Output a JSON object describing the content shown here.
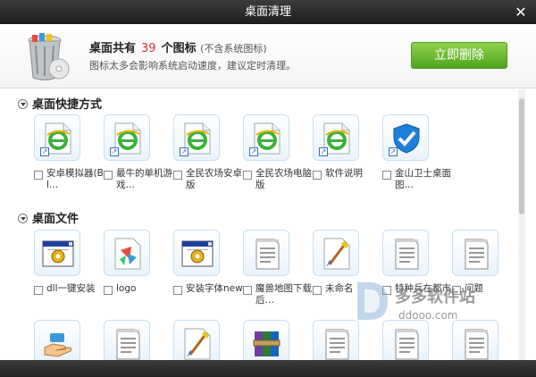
{
  "window": {
    "title": "桌面清理",
    "close_glyph": "✕"
  },
  "header": {
    "summary_prefix": "桌面共有",
    "icon_count": "39",
    "summary_suffix": "个图标",
    "summary_note": "(不含系统图标)",
    "hint": "图标太多会影响系统启动速度，建议定时清理。",
    "delete_button": "立即删除",
    "icon": "recycle-bin-icon"
  },
  "sections": {
    "shortcuts": {
      "title": "桌面快捷方式",
      "items": [
        {
          "label": "安卓模拟器(Bl…",
          "icon": "ie-document-icon"
        },
        {
          "label": "最牛的单机游戏…",
          "icon": "ie-document-icon"
        },
        {
          "label": "全民农场安卓版",
          "icon": "ie-document-icon"
        },
        {
          "label": "全民农场电脑版",
          "icon": "ie-document-icon"
        },
        {
          "label": "软件说明",
          "icon": "ie-document-icon"
        },
        {
          "label": "金山卫士桌面图…",
          "icon": "shield-icon"
        }
      ]
    },
    "files": {
      "title": "桌面文件",
      "items": [
        {
          "label": "dll一键安装",
          "icon": "exe-window-icon"
        },
        {
          "label": "logo",
          "icon": "image-file-icon"
        },
        {
          "label": "安装字体new",
          "icon": "exe-window-icon"
        },
        {
          "label": "魔兽地图下载后…",
          "icon": "text-file-icon"
        },
        {
          "label": "未命名",
          "icon": "paint-file-icon"
        },
        {
          "label": "特种兵在都市",
          "icon": "text-file-icon"
        },
        {
          "label": "问题",
          "icon": "text-file-icon"
        }
      ],
      "row3_icons": [
        "hand-icon",
        "text-file-icon",
        "paint-file-icon",
        "archive-icon",
        "text-file-icon",
        "text-file-icon",
        "text-file-icon"
      ]
    }
  },
  "watermark": {
    "brand": "多多软件站",
    "url": "ddooo.com"
  },
  "colors": {
    "accent_green": "#5db52a",
    "count_red": "#e23030",
    "titlebar": "#2a2a2a"
  }
}
